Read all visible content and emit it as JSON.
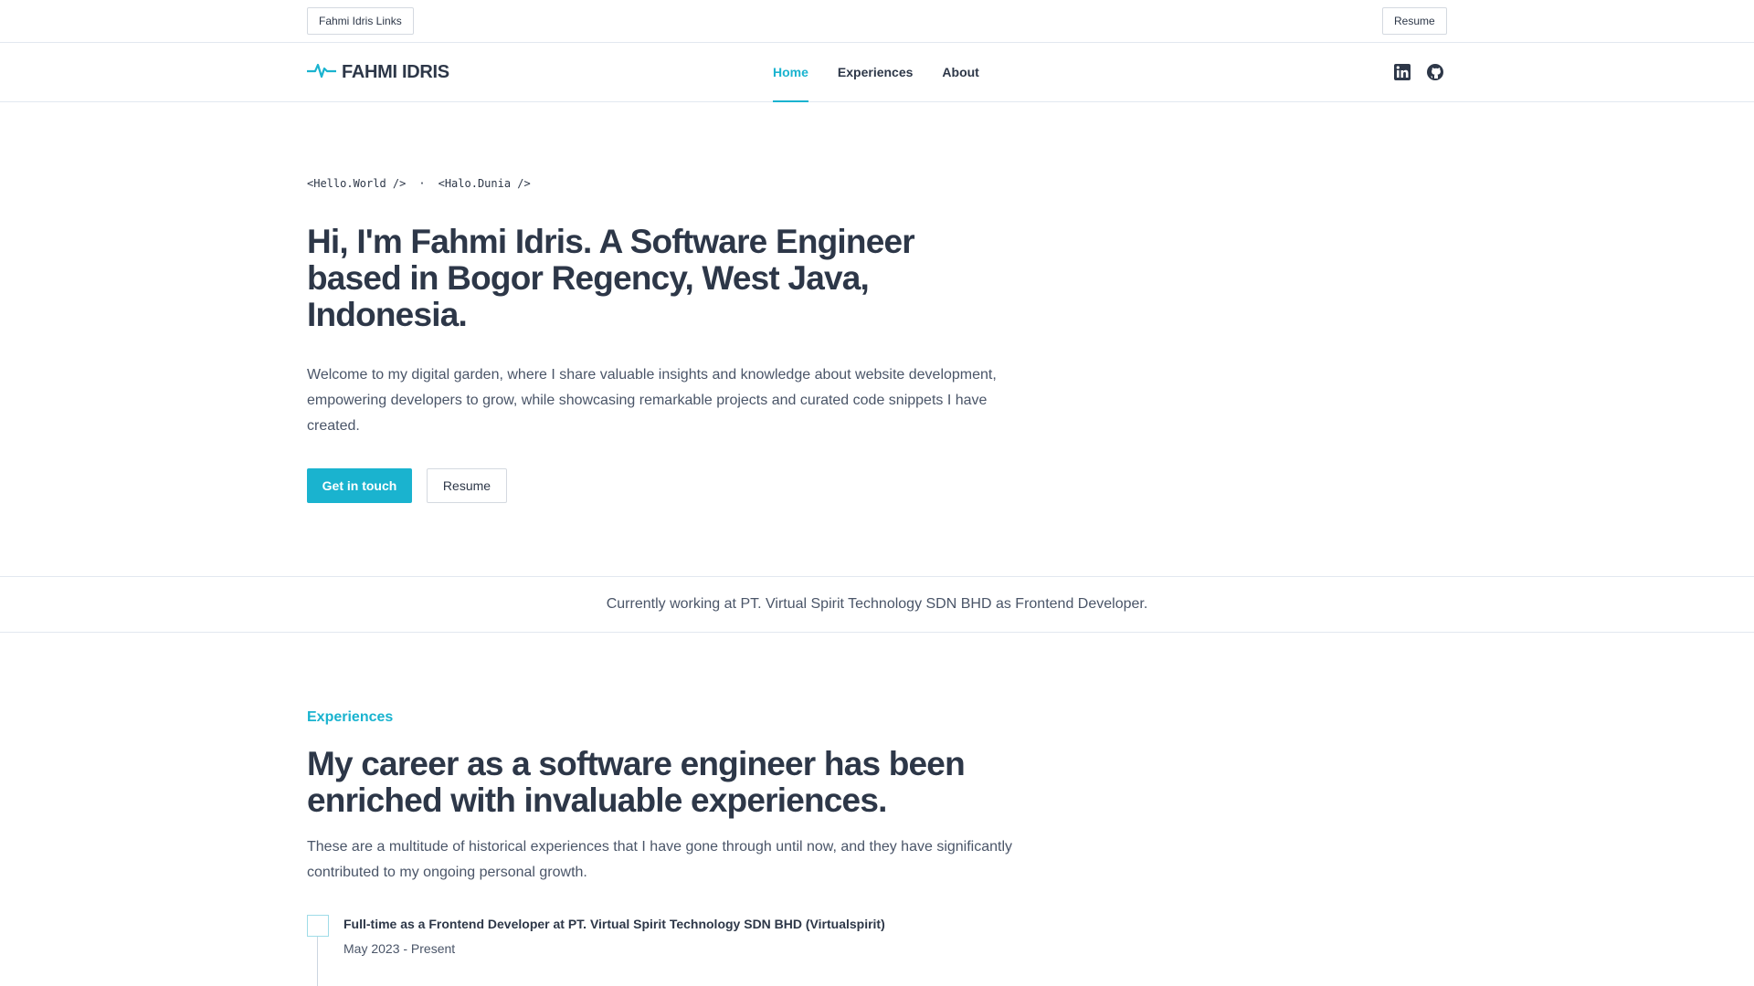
{
  "topbar": {
    "links_label": "Fahmi Idris Links",
    "resume_label": "Resume"
  },
  "nav": {
    "logo_text": "FAHMI IDRIS",
    "items": [
      {
        "label": "Home",
        "active": true
      },
      {
        "label": "Experiences",
        "active": false
      },
      {
        "label": "About",
        "active": false
      }
    ],
    "social": [
      "linkedin-icon",
      "github-icon"
    ]
  },
  "hero": {
    "tagline_en": "<Hello.World />",
    "tagline_sep": "·",
    "tagline_id": "<Halo.Dunia />",
    "title": "Hi, I'm Fahmi Idris. A Software Engineer based in Bogor Regency, West Java, Indonesia.",
    "description": "Welcome to my digital garden, where I share valuable insights and knowledge about website development, empowering developers to grow, while showcasing remarkable projects and curated code snippets I have created.",
    "cta_primary": "Get in touch",
    "cta_secondary": "Resume"
  },
  "current_work": "Currently working at PT. Virtual Spirit Technology SDN BHD as Frontend Developer.",
  "experiences": {
    "label": "Experiences",
    "title": "My career as a software engineer has been enriched with invaluable experiences.",
    "description": "These are a multitude of historical experiences that I have gone through until now, and they have significantly contributed to my ongoing personal growth.",
    "jobs": [
      {
        "title": "Full-time as a Frontend Developer at PT. Virtual Spirit Technology SDN BHD (Virtualspirit)",
        "period": "May 2023 - Present"
      }
    ]
  },
  "colors": {
    "accent": "#1ab3cf",
    "text": "#2d3748",
    "muted": "#4a5568",
    "border": "#e2e8f0"
  }
}
